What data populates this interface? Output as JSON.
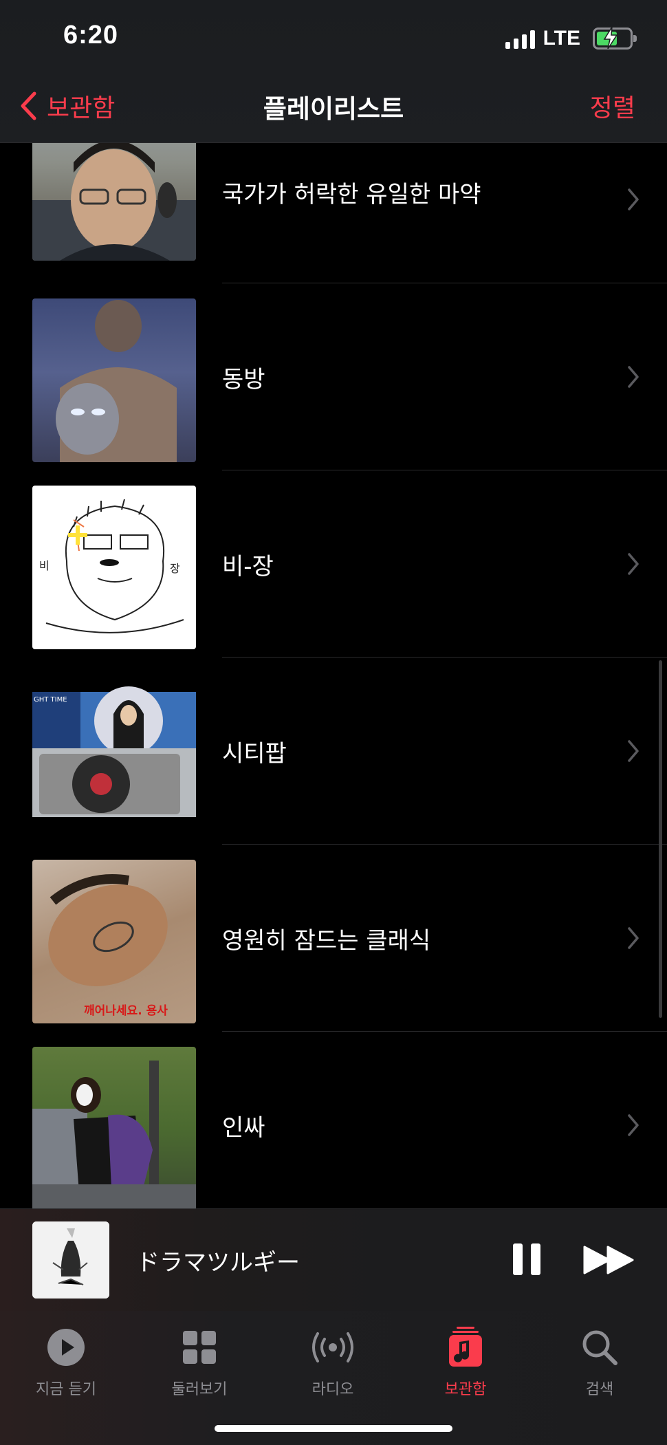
{
  "status_bar": {
    "time": "6:20",
    "network": "LTE"
  },
  "nav": {
    "back_label": "보관함",
    "title": "플레이리스트",
    "sort_label": "정렬"
  },
  "playlists": [
    {
      "name": "국가가 허락한 유일한 마약"
    },
    {
      "name": "동방"
    },
    {
      "name": "비-장"
    },
    {
      "name": "시티팝"
    },
    {
      "name": "영원히 잠드는 클래식"
    },
    {
      "name": "인싸"
    }
  ],
  "thumb_texts": {
    "bijang_left": "비",
    "bijang_right": "장",
    "classic_caption": "깨어나세요. 용사",
    "citypop_caption": "GHT TIME"
  },
  "now_playing": {
    "title": "ドラマツルギー",
    "state": "playing"
  },
  "tabs": [
    {
      "label": "지금 듣기",
      "icon": "play-circle-icon",
      "active": false
    },
    {
      "label": "둘러보기",
      "icon": "grid-icon",
      "active": false
    },
    {
      "label": "라디오",
      "icon": "radio-icon",
      "active": false
    },
    {
      "label": "보관함",
      "icon": "library-icon",
      "active": true
    },
    {
      "label": "검색",
      "icon": "search-icon",
      "active": false
    }
  ],
  "colors": {
    "accent": "#fa3c4c",
    "background": "#000000",
    "inactive": "#8e8e93",
    "battery": "#4cd964"
  }
}
